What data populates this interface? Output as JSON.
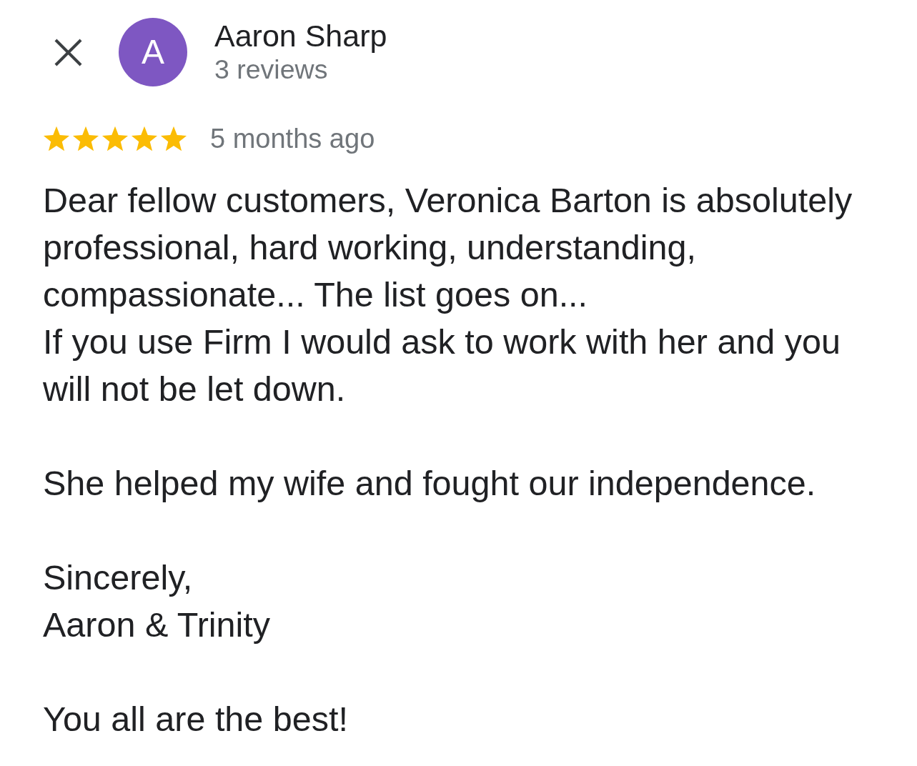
{
  "reviewer": {
    "avatar_letter": "A",
    "name": "Aaron Sharp",
    "review_count": "3 reviews"
  },
  "review": {
    "stars": 5,
    "time": "5 months ago",
    "paragraphs": [
      [
        "Dear fellow customers, Veronica Barton is absolutely professional, hard working, understanding, compassionate... The list goes on...",
        "If you use Firm I would ask to work with her and you will not be let down."
      ],
      [
        "She helped my wife and fought our independence."
      ],
      [
        "Sincerely,",
        "Aaron & Trinity"
      ],
      [
        "You all are the best!"
      ]
    ]
  }
}
